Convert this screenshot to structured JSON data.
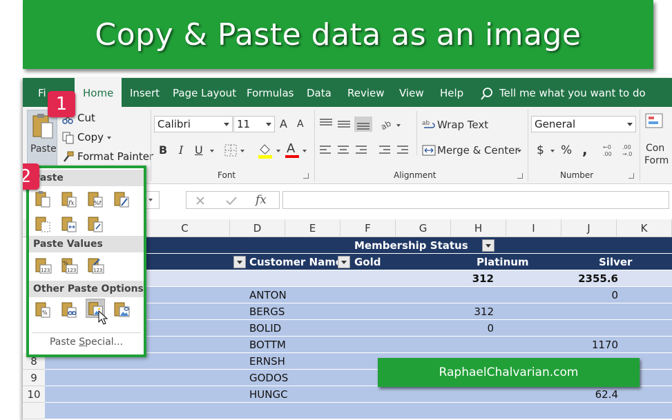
{
  "banner": {
    "title": "Copy & Paste data as an image"
  },
  "tabs": [
    {
      "label": "File",
      "display": "Fi"
    },
    {
      "label": "Home"
    },
    {
      "label": "Insert"
    },
    {
      "label": "Page Layout"
    },
    {
      "label": "Formulas"
    },
    {
      "label": "Data"
    },
    {
      "label": "Review"
    },
    {
      "label": "View"
    },
    {
      "label": "Help"
    }
  ],
  "tell_me": {
    "placeholder": "Tell me what you want to do",
    "icon": "lightbulb-icon"
  },
  "clipboard": {
    "paste_label": "Paste",
    "cut_label": "Cut",
    "copy_label": "Copy",
    "format_painter_label": "Format Painter"
  },
  "font": {
    "name": "Calibri",
    "size": "11",
    "group_label": "Font",
    "bold": "B",
    "italic": "I",
    "underline": "U",
    "grow": "A",
    "shrink": "A",
    "color_letter": "A"
  },
  "alignment": {
    "wrap_label": "Wrap Text",
    "merge_label": "Merge & Center",
    "group_label": "Alignment"
  },
  "number": {
    "format": "General",
    "group_label": "Number",
    "currency": "$",
    "percent": "%",
    "comma": ","
  },
  "styles": {
    "conditional_1": "Con",
    "conditional_2": "Form"
  },
  "formula_bar": {
    "fx": "fx"
  },
  "columns": [
    "C",
    "D",
    "E",
    "F",
    "G",
    "H",
    "I",
    "J",
    "K"
  ],
  "pivot": {
    "header_membership": "Membership Status",
    "header_customer": "Customer Name",
    "header_gold": "Gold",
    "header_platinum": "Platinum",
    "header_silver": "Silver",
    "total_platinum": "312",
    "total_silver": "2355.6",
    "rows": [
      {
        "row": "",
        "customer": "ANTON",
        "gold": "",
        "platinum": "",
        "silver": "0"
      },
      {
        "row": "",
        "customer": "BERGS",
        "gold": "",
        "platinum": "312",
        "silver": ""
      },
      {
        "row": "",
        "customer": "BOLID",
        "gold": "",
        "platinum": "0",
        "silver": ""
      },
      {
        "row": "",
        "customer": "BOTTM",
        "gold": "",
        "platinum": "",
        "silver": "1170"
      },
      {
        "row": "8",
        "customer": "ERNSH",
        "gold": "",
        "platinum": "",
        "silver": ""
      },
      {
        "row": "9",
        "customer": "GODOS",
        "gold": "",
        "platinum": "",
        "silver": ""
      },
      {
        "row": "10",
        "customer": "HUNGC",
        "gold": "",
        "platinum": "",
        "silver": "62.4"
      }
    ]
  },
  "paste_menu": {
    "section_paste": "Paste",
    "section_values": "Paste Values",
    "section_other": "Other Paste Options",
    "special_prefix": "Paste ",
    "special_underline": "S",
    "special_suffix": "pecial..."
  },
  "callouts": {
    "one": "1",
    "two": "2"
  },
  "credit": "RaphaelChalvarian.com",
  "colors": {
    "excel_green": "#217346",
    "banner_green": "#21a038",
    "pivot_dark": "#203864",
    "pivot_light": "#d9e1f2",
    "badge": "#e3284f"
  }
}
